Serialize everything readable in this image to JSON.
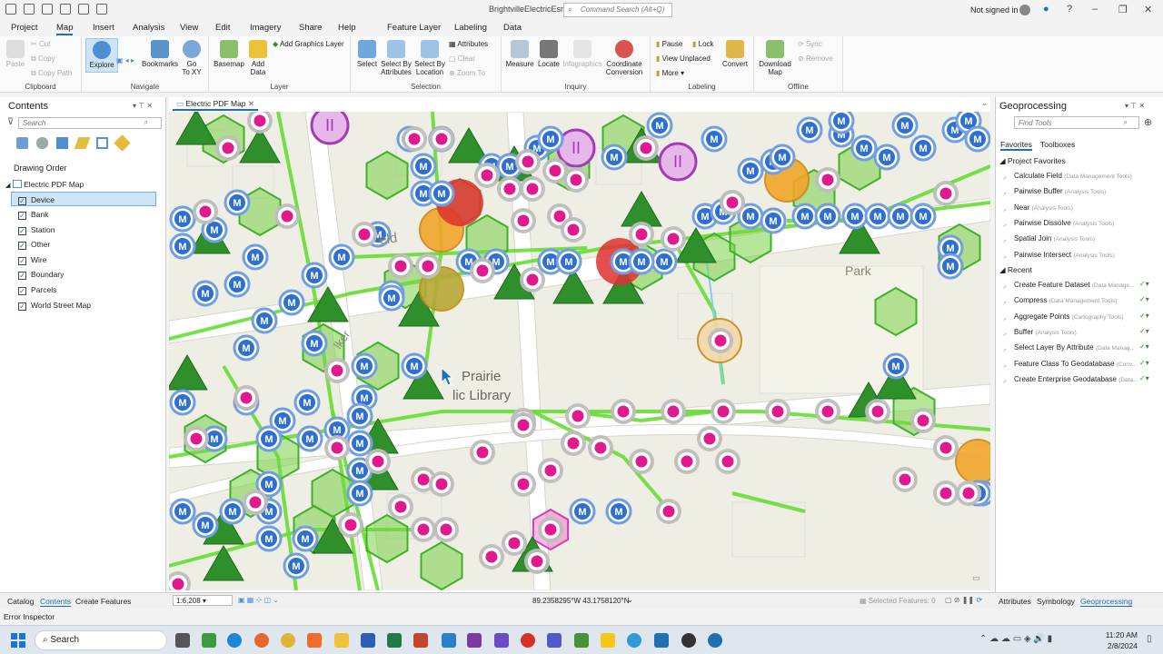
{
  "app": {
    "title": "BrightvilleElectricEsri",
    "command_search_placeholder": "Command Search (Alt+Q)",
    "signin": "Not signed in"
  },
  "tabs": [
    "Project",
    "Map",
    "Insert",
    "Analysis",
    "View",
    "Edit",
    "Imagery",
    "Share",
    "Help",
    "Feature Layer",
    "Labeling",
    "Data"
  ],
  "ribbon": {
    "clipboard": {
      "label": "Clipboard",
      "paste": "Paste",
      "cut": "Cut",
      "copy": "Copy",
      "copy_path": "Copy Path"
    },
    "navigate": {
      "label": "Navigate",
      "explore": "Explore",
      "bookmarks": "Bookmarks",
      "go_to_xy": "Go\nTo XY"
    },
    "layer": {
      "label": "Layer",
      "basemap": "Basemap",
      "add_data": "Add\nData",
      "add_graphics_layer": "Add Graphics Layer"
    },
    "selection": {
      "label": "Selection",
      "select": "Select",
      "select_by_attributes": "Select By\nAttributes",
      "select_by_location": "Select By\nLocation",
      "attributes": "Attributes",
      "clear": "Clear",
      "zoom_to": "Zoom To"
    },
    "inquiry": {
      "label": "Inquiry",
      "measure": "Measure",
      "locate": "Locate",
      "infographics": "Infographics",
      "coordinate_conversion": "Coordinate\nConversion"
    },
    "labeling": {
      "label": "Labeling",
      "pause": "Pause",
      "lock": "Lock",
      "view_unplaced": "View Unplaced",
      "more": "More",
      "convert": "Convert"
    },
    "offline": {
      "label": "Offline",
      "download_map": "Download\nMap",
      "sync": "Sync",
      "remove": "Remove"
    }
  },
  "contents": {
    "title": "Contents",
    "search_placeholder": "Search",
    "drawing_order": "Drawing Order",
    "map_name": "Electric PDF Map",
    "layers": [
      "Device",
      "Bank",
      "Station",
      "Other",
      "Wire",
      "Boundary",
      "Parcels",
      "World Street Map"
    ],
    "selected_layer": "Device"
  },
  "map": {
    "tab": "Electric PDF Map",
    "labels": {
      "street1": "eld",
      "park": "Park",
      "prairie": "Prairie",
      "library": "lic Library",
      "walker": "lker"
    },
    "scale": "1:6,208",
    "coords": "89.2358295°W 43.1758120°N",
    "selected_features": "Selected Features: 0"
  },
  "geoprocessing": {
    "title": "Geoprocessing",
    "search_placeholder": "Find Tools",
    "tabs": [
      "Favorites",
      "Toolboxes"
    ],
    "project_favorites_header": "Project Favorites",
    "favorites": [
      {
        "name": "Calculate Field",
        "box": "(Data Management Tools)"
      },
      {
        "name": "Pairwise Buffer",
        "box": "(Analysis Tools)"
      },
      {
        "name": "Near",
        "box": "(Analysis Tools)"
      },
      {
        "name": "Pairwise Dissolve",
        "box": "(Analysis Tools)"
      },
      {
        "name": "Spatial Join",
        "box": "(Analysis Tools)"
      },
      {
        "name": "Pairwise Intersect",
        "box": "(Analysis Tools)"
      }
    ],
    "recent_header": "Recent",
    "recent": [
      {
        "name": "Create Feature Dataset",
        "box": "(Data Manage..."
      },
      {
        "name": "Compress",
        "box": "(Data Management Tools)"
      },
      {
        "name": "Aggregate Points",
        "box": "(Cartography Tools)"
      },
      {
        "name": "Buffer",
        "box": "(Analysis Tools)"
      },
      {
        "name": "Select Layer By Attribute",
        "box": "(Data Manag..."
      },
      {
        "name": "Feature Class To Geodatabase",
        "box": "(Conv..."
      },
      {
        "name": "Create Enterprise Geodatabase",
        "box": "(Data..."
      }
    ]
  },
  "bottom_tabs_left": [
    "Catalog",
    "Contents",
    "Create Features"
  ],
  "bottom_tabs_right": [
    "Attributes",
    "Symbology",
    "Geoprocessing"
  ],
  "error_inspector": "Error Inspector",
  "taskbar": {
    "search": "Search",
    "time": "11:20 AM",
    "date": "2/8/2024"
  },
  "colors": {
    "accent": "#1f6fb2",
    "device_magenta": "#e0198f",
    "green": "#2f8f2b",
    "m_blue": "#2f6fd0"
  }
}
